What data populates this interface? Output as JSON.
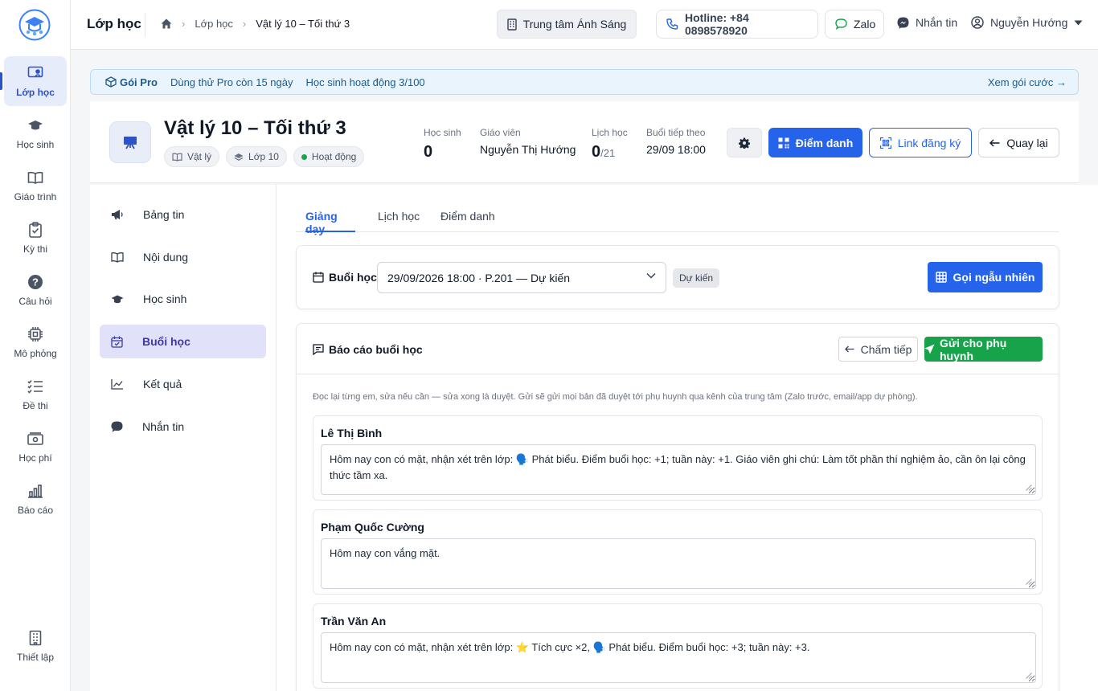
{
  "app": {
    "section_title": "Lớp học"
  },
  "breadcrumb": {
    "items": [
      "Lớp học",
      "Vật lý 10 – Tối thứ 3"
    ]
  },
  "topbar": {
    "center": "Trung tâm Ánh Sáng",
    "hotline": "Hotline: +84 0898578920",
    "zalo": "Zalo",
    "messages": "Nhắn tin",
    "user": "Nguyễn Hướng"
  },
  "rail": [
    {
      "label": "Lớp học",
      "icon": "classroom-icon"
    },
    {
      "label": "Học sinh",
      "icon": "graduation-cap-icon"
    },
    {
      "label": "Giáo trình",
      "icon": "book-icon"
    },
    {
      "label": "Kỳ thi",
      "icon": "clipboard-check-icon"
    },
    {
      "label": "Câu hỏi",
      "icon": "question-icon"
    },
    {
      "label": "Mô phỏng",
      "icon": "chip-icon"
    },
    {
      "label": "Đề thi",
      "icon": "list-check-icon"
    },
    {
      "label": "Học phí",
      "icon": "money-icon"
    },
    {
      "label": "Báo cáo",
      "icon": "bar-chart-icon"
    },
    {
      "label": "Thiết lập",
      "icon": "building-icon"
    }
  ],
  "banner": {
    "plan": "Gói Pro",
    "trial": "Dùng thử Pro còn 15 ngày",
    "students": "Học sinh hoạt động 3/100",
    "link": "Xem gói cước →"
  },
  "class": {
    "title": "Vật lý 10 – Tối thứ 3",
    "tags": [
      "Vật lý",
      "Lớp 10",
      "Hoạt động"
    ],
    "status_color": "#16a34a",
    "stats": {
      "students_label": "Học sinh",
      "students": "0",
      "teacher_label": "Giáo viên",
      "teacher": "Nguyễn Thị Hướng",
      "schedule_label": "Lịch học",
      "schedule": "0",
      "schedule_total": "/21",
      "next_label": "Buổi tiếp theo",
      "next": "29/09 18:00"
    },
    "buttons": {
      "attendance": "Điểm danh",
      "register_link": "Link đăng ký",
      "back": "Quay lại"
    }
  },
  "side_menu": [
    {
      "label": "Bảng tin",
      "icon": "megaphone-icon"
    },
    {
      "label": "Nội dung",
      "icon": "book-open-icon"
    },
    {
      "label": "Học sinh",
      "icon": "graduation-cap-icon"
    },
    {
      "label": "Buổi học",
      "icon": "calendar-check-icon"
    },
    {
      "label": "Kết quả",
      "icon": "line-chart-icon"
    },
    {
      "label": "Nhắn tin",
      "icon": "chat-bubble-icon"
    }
  ],
  "tabs": [
    "Giảng dạy",
    "Lịch học",
    "Điểm danh"
  ],
  "session": {
    "label": "Buổi học",
    "selected": "29/09/2026 18:00 · P.201 — Dự kiến",
    "badge": "Dự kiến",
    "random_button": "Gọi ngẫu nhiên"
  },
  "report": {
    "title": "Báo cáo buổi học",
    "continue_button": "Chấm tiếp",
    "send_button": "Gửi cho phụ huynh",
    "hint": "Đọc lại từng em, sửa nếu cần — sửa xong là duyệt. Gửi sẽ gửi mọi bản đã duyệt tới phụ huynh qua kênh của trung tâm (Zalo trước, email/app dự phòng).",
    "students": [
      {
        "name": "Lê Thị Bình",
        "note": "Hôm nay con có mặt, nhận xét trên lớp: 🗣️ Phát biểu. Điểm buổi học: +1; tuần này: +1. Giáo viên ghi chú: Làm tốt phần thí nghiệm ảo, cần ôn lại công thức tầm xa."
      },
      {
        "name": "Phạm Quốc Cường",
        "note": "Hôm nay con vắng mặt."
      },
      {
        "name": "Trần Văn An",
        "note": "Hôm nay con có mặt, nhận xét trên lớp: ⭐ Tích cực ×2, 🗣️ Phát biểu. Điểm buổi học: +3; tuần này: +3."
      }
    ]
  },
  "colors": {
    "primary": "#2563eb",
    "success": "#16a34a",
    "active_menu": "#e2e1fa"
  }
}
